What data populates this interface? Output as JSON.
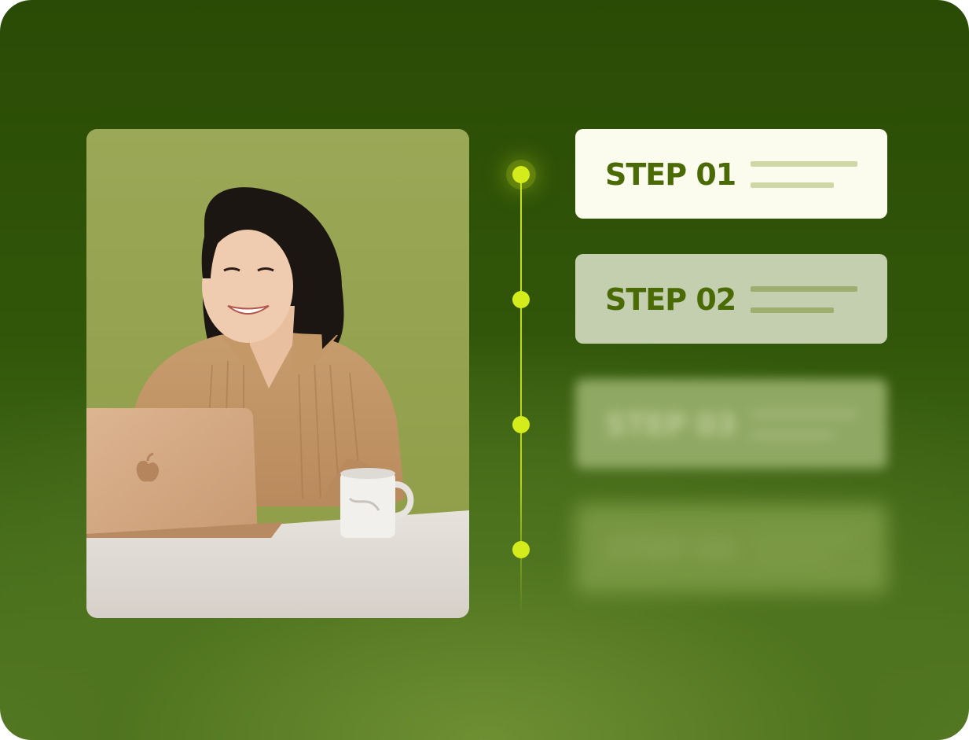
{
  "steps": [
    {
      "label": "STEP 01",
      "state": "active"
    },
    {
      "label": "STEP 02",
      "state": "next"
    },
    {
      "label": "STEP 03",
      "state": "faded"
    },
    {
      "label": "STEP 04",
      "state": "faded"
    }
  ],
  "colors": {
    "background_dark": "#2a4b05",
    "accent": "#d4ec1c",
    "step_text": "#4a6a06",
    "card_active": "#fbfcee"
  },
  "photo": {
    "subject": "person-at-laptop-illustration"
  }
}
